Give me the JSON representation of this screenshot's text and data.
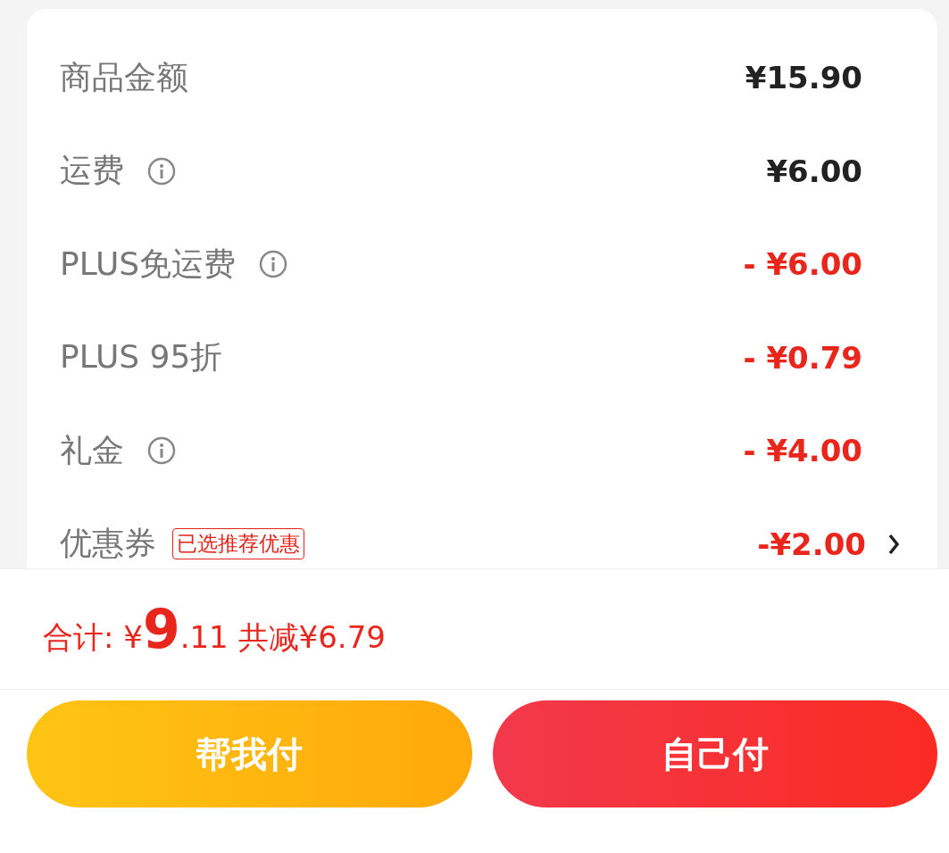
{
  "rows": [
    {
      "label": "商品金额",
      "kind": "charge",
      "info": false,
      "value": "¥15.90",
      "more": false
    },
    {
      "label": "运费",
      "kind": "charge",
      "info": true,
      "value": "¥6.00",
      "more": false
    },
    {
      "label": "PLUS免运费",
      "kind": "discount",
      "info": true,
      "value": "- ¥6.00",
      "more": false
    },
    {
      "label": "PLUS 95折",
      "kind": "discount",
      "info": false,
      "value": "- ¥0.79",
      "more": false
    },
    {
      "label": "礼金",
      "kind": "discount",
      "info": true,
      "value": "- ¥4.00",
      "more": false
    },
    {
      "label": "优惠券",
      "kind": "discount",
      "info": false,
      "tag": "已选推荐优惠",
      "value": "-¥2.00",
      "more": true
    }
  ],
  "total": {
    "label": "合计:",
    "currency": "¥",
    "integer": "9",
    "decimal": ".11",
    "saved": "共减¥6.79"
  },
  "buttons": [
    {
      "label": "帮我付",
      "kind": "friend"
    },
    {
      "label": "自己付",
      "kind": "self"
    }
  ]
}
